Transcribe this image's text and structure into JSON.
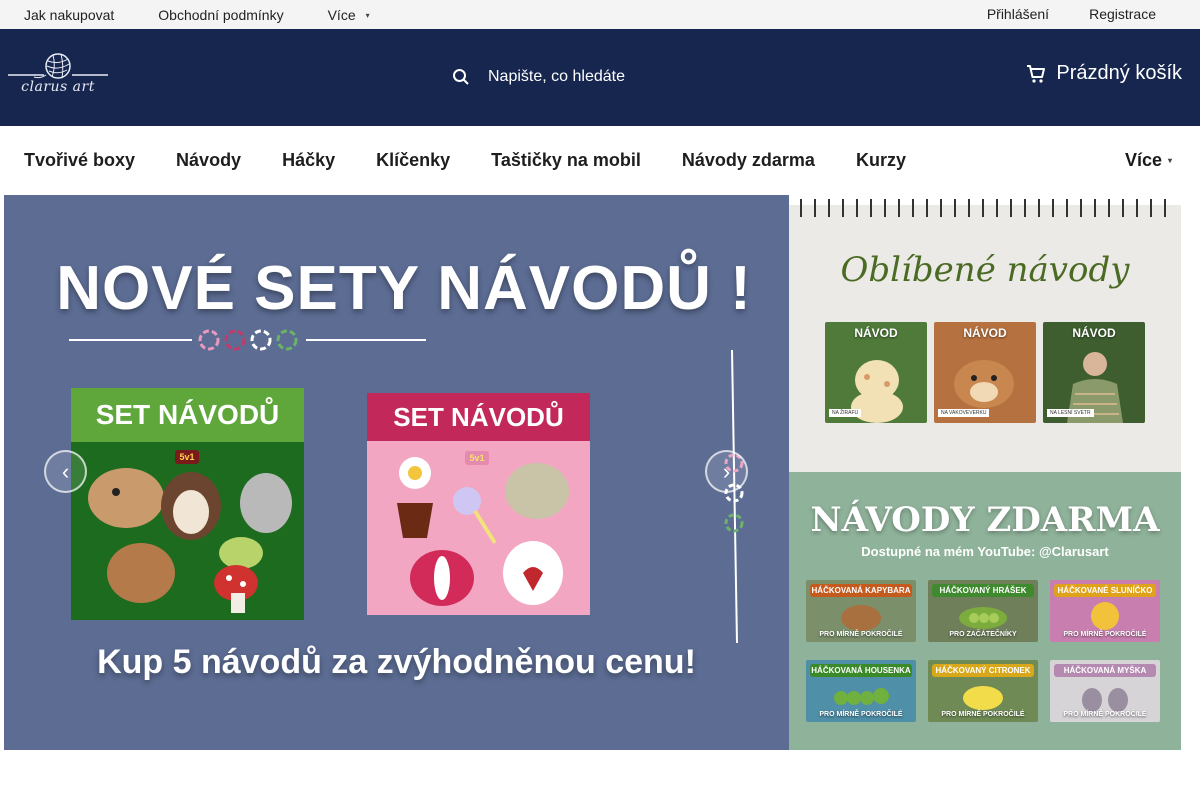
{
  "topbar": {
    "links": [
      "Jak nakupovat",
      "Obchodní podmínky"
    ],
    "more_label": "Více",
    "login": "Přihlášení",
    "register": "Registrace"
  },
  "header": {
    "logo_text": "clarus art",
    "search_placeholder": "Napište, co hledáte",
    "cart_label": "Prázdný košík",
    "colors": {
      "header_bg": "#16264f",
      "topbar_bg": "#f4f4f4"
    }
  },
  "nav": {
    "items": [
      "Tvořivé boxy",
      "Návody",
      "Háčky",
      "Klíčenky",
      "Taštičky na mobil",
      "Návody zdarma",
      "Kurzy"
    ],
    "more_label": "Více"
  },
  "hero": {
    "title": "NOVÉ SETY NÁVODŮ !",
    "card_left_label": "SET NÁVODŮ",
    "card_left_badge": "5v1",
    "card_right_label": "SET NÁVODŮ",
    "card_right_badge": "5v1",
    "bottom_text": "Kup 5 návodů za zvýhodněnou cenu!",
    "colors": {
      "bg": "#5c6c93",
      "green_card": "#1d6b1f",
      "pink_card": "#f2a6c2",
      "pink_bar": "#c2285a"
    }
  },
  "side_top": {
    "title": "Oblíbené návody",
    "thumbs": [
      {
        "label": "NÁVOD",
        "tag": "NA ŽIRAFU"
      },
      {
        "label": "NÁVOD",
        "tag": "NA VAKOVEVERKU"
      },
      {
        "label": "NÁVOD",
        "tag": "NA LESNÍ SVETR"
      }
    ]
  },
  "side_bottom": {
    "title": "NÁVODY ZDARMA",
    "subtitle": "Dostupné na mém YouTube: @Clarusart",
    "tiles": [
      {
        "head": "HÁČKOVANÁ KAPYBARA",
        "foot": "PRO MÍRNĚ POKROČILÉ"
      },
      {
        "head": "HÁČKOVANÝ HRÁŠEK",
        "foot": "PRO ZAČÁTEČNÍKY"
      },
      {
        "head": "HÁČKOVANÉ SLUNÍČKO",
        "foot": "PRO MÍRNĚ POKROČILÉ"
      },
      {
        "head": "HÁČKOVANÁ HOUSENKA",
        "foot": "PRO MÍRNĚ POKROČILÉ"
      },
      {
        "head": "HÁČKOVANÝ CITRONEK",
        "foot": "PRO MÍRNĚ POKROČILÉ"
      },
      {
        "head": "HÁČKOVANÁ MYŠKA",
        "foot": "PRO MÍRNĚ POKROČILÉ"
      }
    ]
  },
  "icons": {
    "search": "search-icon",
    "cart": "cart-icon",
    "chevron": "chevron-down-icon",
    "prev": "chevron-left-icon",
    "next": "chevron-right-icon"
  }
}
